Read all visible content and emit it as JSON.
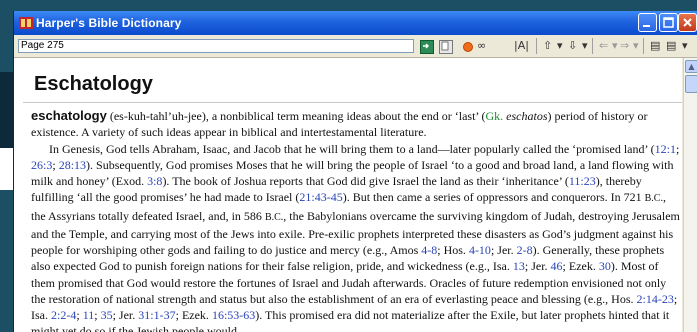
{
  "window": {
    "title": "Harper's Bible Dictionary",
    "title_color": "#1f62de",
    "close_color": "#c2391b"
  },
  "toolbar": {
    "page_value": "Page 275",
    "caret": "▾",
    "up_arrow": "⇧",
    "down_arrow": "⇩",
    "back_arrow": "⇐",
    "forward_arrow": "⇒",
    "search_glyph": "⌕",
    "binoculars_glyph": "∞",
    "book_glyph": "|A|",
    "panel_glyph": "▤",
    "more_glyph": "▤"
  },
  "scrollbar": {
    "up_glyph": "▲"
  },
  "article": {
    "heading": "Eschatology",
    "headword": "eschatology",
    "p1": {
      "a": " (es-kuh-tahl’uh-jee), a nonbiblical term meaning ideas about the end or ‘last’ (",
      "gk": "Gk. ",
      "gk_word": "eschatos",
      "b": ") period of history or existence. A variety of such ideas appear in biblical and intertestamental literature."
    },
    "p2": {
      "a": "In Genesis, God tells Abraham, Isaac, and Jacob that he will bring them to a land—later popularly called the ‘promised land’ (",
      "r1": "12:1",
      "s1": "; ",
      "r2": "26:3",
      "s2": "; ",
      "r3": "28:13",
      "b": "). Subsequently, God promises Moses that he will bring the people of Israel ‘to a good and broad land, a land flowing with milk and honey’ (Exod. ",
      "r4": "3:8",
      "c": "). The book of Joshua reports that God did give Israel the land as their ‘inheritance’ (",
      "r5": "11:23",
      "d": "), thereby fulfilling ‘all the good promises’ he had made to Israel (",
      "r6": "21:43-45",
      "e": "). But then came a series of oppressors and conquerors. In 721 ",
      "bc1": "B.C.",
      "f": ", the Assyrians totally defeated Israel, and, in 586 ",
      "bc2": "B.C.",
      "g": ", the Babylonians overcame the surviving kingdom of Judah, destroying Jerusalem and the Temple, and carrying most of the Jews into exile. Pre-exilic prophets interpreted these disasters as God’s judgment against his people for worshiping other gods and failing to do justice and mercy (e.g., Amos ",
      "r7": "4-8",
      "h": "; Hos. ",
      "r8": "4-10",
      "i": "; Jer. ",
      "r9": "2-8",
      "j": "). Generally, these prophets also expected God to punish foreign nations for their false religion, pride, and wickedness (e.g., Isa. ",
      "r10": "13",
      "k": "; Jer. ",
      "r11": "46",
      "l": "; Ezek. ",
      "r12": "30",
      "m": "). Most of them promised that God would restore the fortunes of Israel and Judah afterwards. Oracles of future redemption envisioned not only the restoration of national strength and status but also the establishment of an era of everlasting peace and blessing (e.g., Hos. ",
      "r13": "2:14-23",
      "n": "; Isa. ",
      "r14": "2:2-4",
      "o": "; ",
      "r15": "11",
      "p": "; ",
      "r16": "35",
      "q": "; Jer. ",
      "r17": "31:1-37",
      "r": "; Ezek. ",
      "r18": "16:53-63",
      "s": "). This promised era did not materialize after the Exile, but later prophets hinted that it might yet do so if the Jewish people would"
    }
  }
}
